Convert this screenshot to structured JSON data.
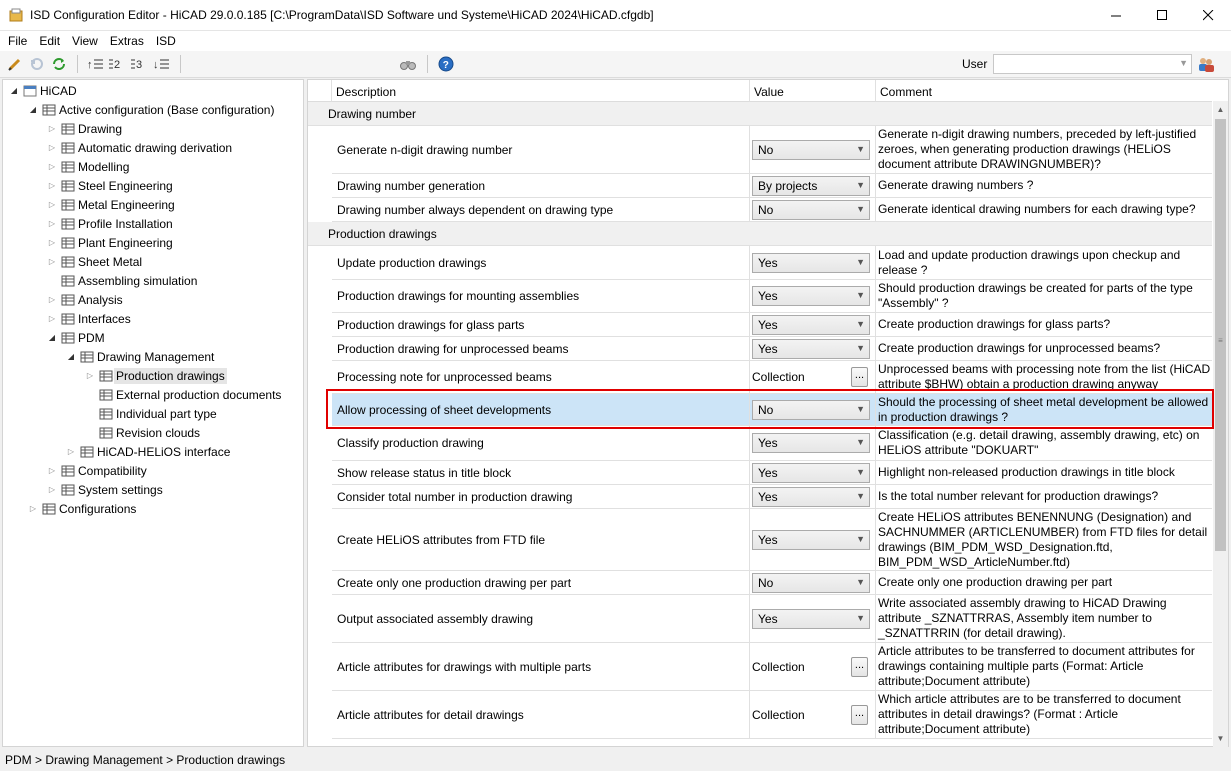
{
  "window": {
    "title": "ISD Configuration Editor  -  HiCAD 29.0.0.185 [C:\\ProgramData\\ISD Software und Systeme\\HiCAD 2024\\HiCAD.cfgdb]"
  },
  "menu": [
    "File",
    "Edit",
    "View",
    "Extras",
    "ISD"
  ],
  "toolbar": {
    "user_label": "User",
    "user_value": ""
  },
  "colors": {
    "selection": "#cce4f7",
    "highlight_border": "#e00000",
    "folder": "#e8b84a"
  },
  "tree": [
    {
      "label": "HiCAD",
      "icon": "root-icon"
    },
    {
      "label": "Active configuration (Base configuration)",
      "icon": "grid-icon"
    },
    {
      "label": "Drawing",
      "icon": "grid-icon"
    },
    {
      "label": "Automatic drawing derivation",
      "icon": "grid-icon"
    },
    {
      "label": "Modelling",
      "icon": "grid-icon"
    },
    {
      "label": "Steel Engineering",
      "icon": "grid-icon"
    },
    {
      "label": "Metal Engineering",
      "icon": "grid-icon"
    },
    {
      "label": "Profile Installation",
      "icon": "grid-icon"
    },
    {
      "label": "Plant Engineering",
      "icon": "grid-icon"
    },
    {
      "label": "Sheet Metal",
      "icon": "grid-icon"
    },
    {
      "label": "Assembling simulation",
      "icon": "grid-icon"
    },
    {
      "label": "Analysis",
      "icon": "grid-icon"
    },
    {
      "label": "Interfaces",
      "icon": "grid-icon"
    },
    {
      "label": "PDM",
      "icon": "grid-icon"
    },
    {
      "label": "Drawing Management",
      "icon": "grid-icon"
    },
    {
      "label": "Production drawings",
      "icon": "grid-icon"
    },
    {
      "label": "External production documents",
      "icon": "grid-icon"
    },
    {
      "label": "Individual part type",
      "icon": "grid-icon"
    },
    {
      "label": "Revision clouds",
      "icon": "grid-icon"
    },
    {
      "label": "HiCAD-HELiOS interface",
      "icon": "grid-icon"
    },
    {
      "label": "Compatibility",
      "icon": "grid-icon"
    },
    {
      "label": "System settings",
      "icon": "grid-icon"
    },
    {
      "label": "Configurations",
      "icon": "grid-icon"
    }
  ],
  "grid": {
    "headers": {
      "description": "Description",
      "value": "Value",
      "comment": "Comment"
    },
    "sections": [
      "Drawing number",
      "Production drawings"
    ],
    "rows": [
      {
        "desc": "Generate n-digit drawing number",
        "value": "No",
        "comment": [
          "Generate n-digit drawing numbers, preceded by left-justified",
          "zeroes, when generating production drawings (HELiOS",
          "document attribute DRAWINGNUMBER)?"
        ]
      },
      {
        "desc": "Drawing number generation",
        "value": "By projects",
        "comment": [
          "Generate drawing numbers ?"
        ]
      },
      {
        "desc": "Drawing number always dependent on drawing type",
        "value": "No",
        "comment": [
          "Generate identical drawing numbers for each drawing type?"
        ]
      },
      {
        "desc": "Update production drawings",
        "value": "Yes",
        "comment": [
          "Load and update production drawings upon checkup and",
          "release ?"
        ]
      },
      {
        "desc": "Production drawings for mounting assemblies",
        "value": "Yes",
        "comment": [
          "Should production drawings be created for parts of the type",
          "\"Assembly\" ?"
        ]
      },
      {
        "desc": "Production drawings for glass parts",
        "value": "Yes",
        "comment": [
          "Create production drawings for glass parts?"
        ]
      },
      {
        "desc": "Production drawing for unprocessed beams",
        "value": "Yes",
        "comment": [
          "Create production drawings for unprocessed beams?"
        ]
      },
      {
        "desc": "Processing note for unprocessed beams",
        "value": "Collection",
        "comment": [
          "Unprocessed beams with processing note from the list (HiCAD",
          "attribute $BHW) obtain a production drawing anyway"
        ]
      },
      {
        "desc": "Allow processing of sheet developments",
        "value": "No",
        "comment": [
          "Should the processing of sheet metal development be allowed",
          "in production drawings ?"
        ]
      },
      {
        "desc": "Classify production drawing",
        "value": "Yes",
        "comment": [
          "Classification (e.g. detail drawing, assembly drawing, etc) on",
          "HELiOS attribute \"DOKUART\""
        ]
      },
      {
        "desc": "Show release status in title block",
        "value": "Yes",
        "comment": [
          "Highlight non-released production drawings in title block"
        ]
      },
      {
        "desc": "Consider total number in production drawing",
        "value": "Yes",
        "comment": [
          "Is the total number relevant for production drawings?"
        ]
      },
      {
        "desc": "Create HELiOS attributes from FTD file",
        "value": "Yes",
        "comment": [
          "Create HELiOS attributes BENENNUNG (Designation) and",
          "SACHNUMMER (ARTICLENUMBER) from  FTD files for detail",
          "drawings (BIM_PDM_WSD_Designation.ftd,",
          "BIM_PDM_WSD_ArticleNumber.ftd)"
        ]
      },
      {
        "desc": "Create only one production drawing per part",
        "value": "No",
        "comment": [
          "Create only one production drawing per part"
        ]
      },
      {
        "desc": "Output associated assembly drawing",
        "value": "Yes",
        "comment": [
          "Write associated assembly drawing to HiCAD Drawing",
          "attribute _SZNATTRRAS, Assembly item number to",
          "_SZNATTRRIN (for detail drawing)."
        ]
      },
      {
        "desc": "Article attributes for drawings with multiple parts",
        "value": "Collection",
        "comment": [
          "Article attributes to be transferred to document attributes for",
          "drawings containing multiple parts  (Format: Article",
          "attribute;Document attribute)"
        ]
      },
      {
        "desc": "Article attributes for detail drawings",
        "value": "Collection",
        "comment": [
          "Which article attributes are to be transferred to document",
          "attributes in detail drawings?  (Format : Article",
          "attribute;Document attribute)"
        ]
      }
    ]
  },
  "status": "PDM > Drawing Management > Production drawings"
}
